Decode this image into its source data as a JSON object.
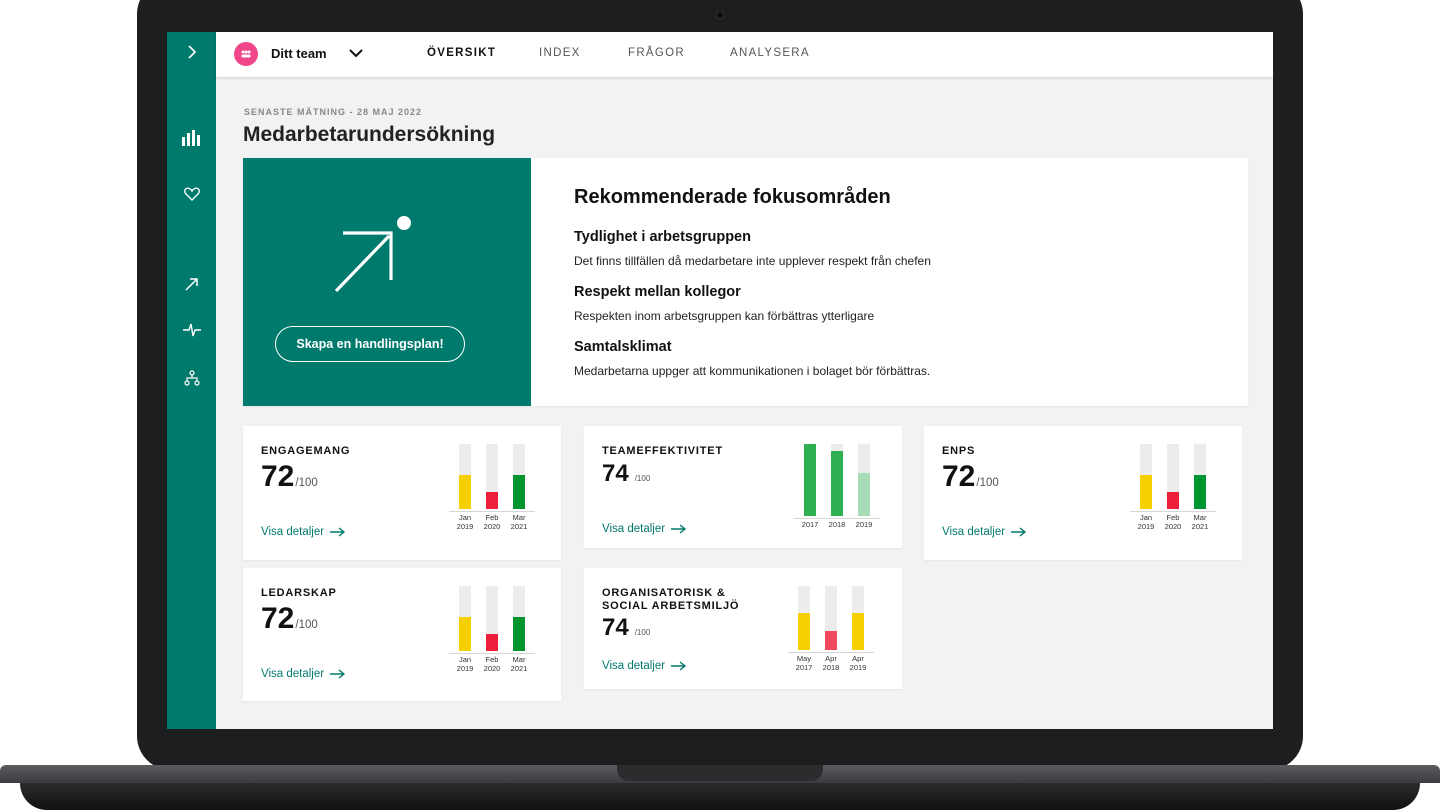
{
  "sidebar": {
    "items": [
      {
        "name": "expand-icon"
      },
      {
        "name": "bar-chart-icon"
      },
      {
        "name": "heart-icon"
      },
      {
        "name": "arrow-up-right-icon"
      },
      {
        "name": "pulse-icon"
      },
      {
        "name": "org-chart-icon"
      }
    ]
  },
  "header": {
    "team_name": "Ditt team",
    "tabs": [
      {
        "label": "ÖVERSIKT",
        "active": true
      },
      {
        "label": "INDEX",
        "active": false
      },
      {
        "label": "FRÅGOR",
        "active": false
      },
      {
        "label": "ANALYSERA",
        "active": false
      }
    ]
  },
  "page": {
    "eyebrow": "SENASTE MÄTNING - 28 MAJ 2022",
    "title": "Medarbetarundersökning"
  },
  "hero": {
    "button_label": "Skapa en handlingsplan!",
    "title": "Rekommenderade fokusområden",
    "items": [
      {
        "title": "Tydlighet i arbetsgruppen",
        "desc": "Det finns tillfällen då medarbetare inte upplever respekt från chefen"
      },
      {
        "title": "Respekt mellan kollegor",
        "desc": "Respekten inom arbetsgruppen kan förbättras ytterligare"
      },
      {
        "title": "Samtalsklimat",
        "desc": "Medarbetarna uppger att kommunikationen i bolaget bör förbättras."
      }
    ]
  },
  "cards": [
    {
      "title": "ENGAGEMANG",
      "score": "72",
      "out_of": "/100",
      "link": "Visa detaljer",
      "bars": [
        {
          "label": [
            "Jan",
            "2019"
          ],
          "value": 0.52,
          "color": "#f5d000"
        },
        {
          "label": [
            "Feb",
            "2020"
          ],
          "value": 0.26,
          "color": "#ee1f3a"
        },
        {
          "label": [
            "Mar",
            "2021"
          ],
          "value": 0.52,
          "color": "#00952e"
        }
      ]
    },
    {
      "title": "TEAMEFFEKTIVITET",
      "score": "74",
      "out_of": "/100",
      "link": "Visa detaljer",
      "bars": [
        {
          "label": [
            "2017"
          ],
          "value": 1.0,
          "color": "#2daf52"
        },
        {
          "label": [
            "2018"
          ],
          "value": 0.9,
          "color": "#2daf52"
        },
        {
          "label": [
            "2019"
          ],
          "value": 0.6,
          "color": "#a8dcb6"
        }
      ]
    },
    {
      "title": "ENPS",
      "score": "72",
      "out_of": "/100",
      "link": "Visa detaljer",
      "bars": [
        {
          "label": [
            "Jan",
            "2019"
          ],
          "value": 0.52,
          "color": "#f5d000"
        },
        {
          "label": [
            "Feb",
            "2020"
          ],
          "value": 0.26,
          "color": "#ee1f3a"
        },
        {
          "label": [
            "Mar",
            "2021"
          ],
          "value": 0.52,
          "color": "#00952e"
        }
      ]
    },
    {
      "title": "LEDARSKAP",
      "score": "72",
      "out_of": "/100",
      "link": "Visa detaljer",
      "bars": [
        {
          "label": [
            "Jan",
            "2019"
          ],
          "value": 0.52,
          "color": "#f5d000"
        },
        {
          "label": [
            "Feb",
            "2020"
          ],
          "value": 0.26,
          "color": "#ee1f3a"
        },
        {
          "label": [
            "Mar",
            "2021"
          ],
          "value": 0.52,
          "color": "#00952e"
        }
      ]
    },
    {
      "title": "ORGANISATORISK & SOCIAL ARBETSMILJÖ",
      "title_lines": [
        "ORGANISATORISK &",
        "SOCIAL ARBETSMILJÖ"
      ],
      "score": "74",
      "out_of": "/100",
      "link": "Visa detaljer",
      "bars": [
        {
          "label": [
            "May",
            "2017"
          ],
          "value": 0.58,
          "color": "#f5d000"
        },
        {
          "label": [
            "Apr",
            "2018"
          ],
          "value": 0.3,
          "color": "#ee4a5c"
        },
        {
          "label": [
            "Apr",
            "2019"
          ],
          "value": 0.58,
          "color": "#f5d000"
        }
      ]
    }
  ]
}
